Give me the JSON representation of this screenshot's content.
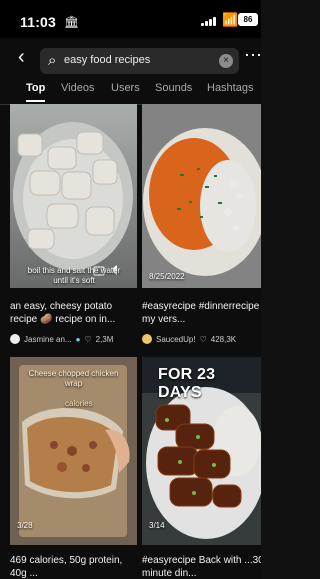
{
  "status": {
    "time": "11:03",
    "battery": "86"
  },
  "search": {
    "query": "easy food recipes"
  },
  "tabs": [
    "Top",
    "Videos",
    "Users",
    "Sounds",
    "Hashtags"
  ],
  "posts": [
    {
      "caption": "boil this and salt the water until it's soft",
      "title": "an easy, cheesy potato recipe 🥔 recipe on in...",
      "user": "Jasmine an...",
      "likes": "2,3M"
    },
    {
      "date": "8/25/2022",
      "title": "#easyrecipe #dinnerrecipe my vers...",
      "user": "SaucedUp!",
      "likes": "428,3K"
    },
    {
      "overlay": "Cheese chopped chicken wrap",
      "overlay2": "calories",
      "counter": "3/28",
      "title": "469 calories, 50g protein, 40g ..."
    },
    {
      "overlay": "FOR 23 DAYS",
      "counter": "3/14",
      "title": "#easyrecipe Back with ...30 minute din..."
    }
  ]
}
